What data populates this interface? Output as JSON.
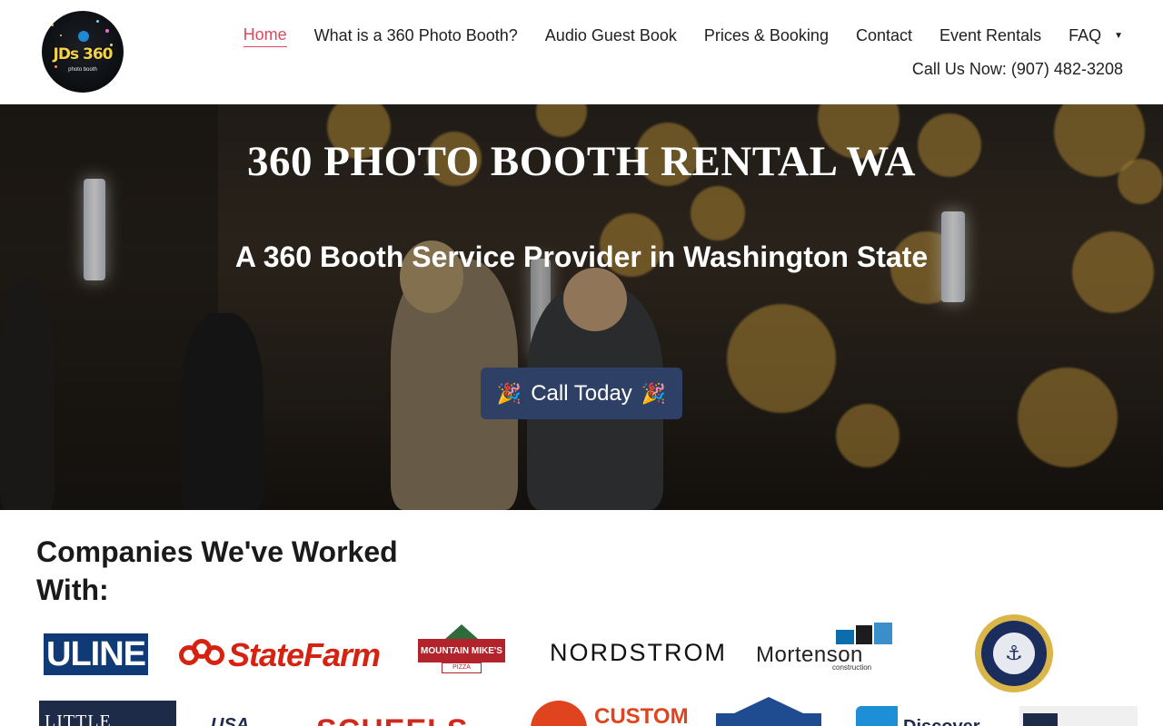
{
  "header": {
    "logo_text": "JDs 360",
    "logo_subtext": "photo booth",
    "nav": [
      {
        "label": "Home",
        "active": true
      },
      {
        "label": "What is a 360 Photo Booth?"
      },
      {
        "label": "Audio Guest Book"
      },
      {
        "label": "Prices & Booking"
      },
      {
        "label": "Contact"
      },
      {
        "label": "Event Rentals"
      },
      {
        "label": "FAQ",
        "has_dropdown": true
      }
    ],
    "phone": "Call Us Now: (907) 482-3208",
    "accent_color": "#d94a5e"
  },
  "hero": {
    "title": "360 PHOTO BOOTH RENTAL WA",
    "subtitle": "A 360 Booth Service Provider in Washington State",
    "cta_label": "Call Today",
    "cta_icon": "party-popper-icon",
    "cta_color": "#2e4066"
  },
  "companies": {
    "title": "Companies We've Worked With:",
    "logos_row1": {
      "uline": "ULINE",
      "statefarm": "StateFarm",
      "mountainmikes": "MOUNTAIN MIKE'S",
      "mountainmikes_sub": "PIZZA",
      "nordstrom": "NORDSTROM",
      "mortenson": "Mortenson",
      "mortenson_sub": "construction"
    },
    "logos_row2": {
      "littlecreek": "LITTLE CREEK",
      "usa": "USA",
      "scheels": "SCHEELS",
      "custom": "CUSTOM",
      "discovery": "Discover"
    }
  }
}
